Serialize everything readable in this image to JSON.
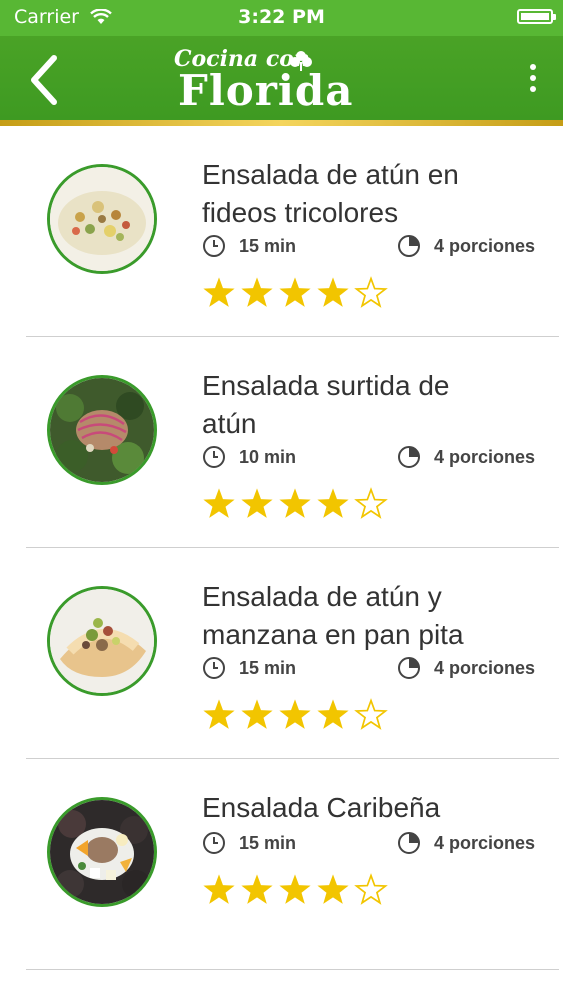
{
  "status_bar": {
    "carrier": "Carrier",
    "time": "3:22 PM"
  },
  "header": {
    "logo_small": "Cocina con",
    "logo_big": "Florida"
  },
  "colors": {
    "green": "#58b734",
    "star": "#f2c500",
    "gold": "#e9c44a"
  },
  "recipes": [
    {
      "title_line1": "Ensalada de atún en",
      "title_line2": "fideos tricolores",
      "time": "15 min",
      "portions": "4 porciones",
      "rating": 4,
      "max_rating": 5
    },
    {
      "title_line1": "Ensalada surtida de",
      "title_line2": "atún",
      "time": "10 min",
      "portions": "4 porciones",
      "rating": 4,
      "max_rating": 5
    },
    {
      "title_line1": "Ensalada de atún y",
      "title_line2": "manzana en pan pita",
      "time": "15 min",
      "portions": "4 porciones",
      "rating": 4,
      "max_rating": 5
    },
    {
      "title_line1": "Ensalada Caribeña",
      "title_line2": "",
      "time": "15 min",
      "portions": "4 porciones",
      "rating": 4,
      "max_rating": 5
    }
  ]
}
